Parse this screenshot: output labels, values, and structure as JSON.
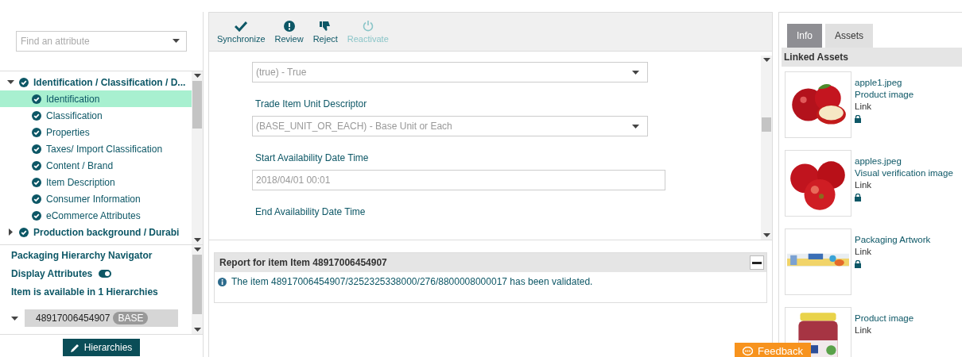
{
  "attribute_search": {
    "placeholder": "Find an attribute"
  },
  "tree": [
    {
      "label": "Identification / Classification / D...",
      "checked": true,
      "expanded": true,
      "selected": false,
      "children": [
        {
          "label": "Identification",
          "checked": true,
          "selected": true
        },
        {
          "label": "Classification",
          "checked": true,
          "selected": false
        },
        {
          "label": "Properties",
          "checked": true,
          "selected": false
        },
        {
          "label": "Taxes/ Import Classification",
          "checked": true,
          "selected": false
        },
        {
          "label": "Content / Brand",
          "checked": true,
          "selected": false
        },
        {
          "label": "Item Description",
          "checked": true,
          "selected": false
        },
        {
          "label": "Consumer Information",
          "checked": true,
          "selected": false
        },
        {
          "label": "eCommerce Attributes",
          "checked": true,
          "selected": false
        }
      ]
    },
    {
      "label": "Production background / Durabi",
      "checked": true,
      "expanded": false,
      "selected": false
    }
  ],
  "navigator": {
    "title": "Packaging Hierarchy Navigator",
    "display_attributes": {
      "label": "Display Attributes",
      "on": true
    },
    "availability": "Item is available in 1 Hierarchies",
    "node": {
      "gtin": "48917006454907",
      "badge": "BASE",
      "expanded": true
    },
    "button": "Hierarchies"
  },
  "toolbar": [
    {
      "kind": "check",
      "label": "Synchronize",
      "disabled": false
    },
    {
      "kind": "alert",
      "label": "Review",
      "disabled": false
    },
    {
      "kind": "thumbdown",
      "label": "Reject",
      "disabled": false
    },
    {
      "kind": "power",
      "label": "Reactivate",
      "disabled": true
    }
  ],
  "form_fields": [
    {
      "kind": "select",
      "value": "(true) - True"
    },
    {
      "kind": "select",
      "label": "Trade Item Unit Descriptor",
      "value": "(BASE_UNIT_OR_EACH) - Base Unit or Each"
    },
    {
      "kind": "text",
      "label": "Start Availability Date Time",
      "value": "2018/04/01 00:01"
    },
    {
      "kind": "label",
      "label": "End Availability Date Time"
    }
  ],
  "report": {
    "title": "Report for item Item 48917006454907",
    "message": "The item 48917006454907/3252325338000/276/8800008000017 has been validated."
  },
  "tabs": [
    {
      "label": "Info",
      "selected": false
    },
    {
      "label": "Assets",
      "selected": true
    }
  ],
  "linked_assets": {
    "title": "Linked Assets",
    "items": [
      {
        "kind": "picture",
        "name": "apple1.jpeg",
        "type": "Product image",
        "link": "Link",
        "locked": true
      },
      {
        "kind": "picture",
        "name": "apples.jpeg",
        "type": "Visual verification image",
        "link": "Link",
        "locked": true
      },
      {
        "kind": "picture",
        "type": "Packaging Artwork",
        "link": "Link",
        "locked": true
      },
      {
        "kind": "picture",
        "type": "Product image",
        "link": "Link"
      }
    ]
  },
  "feedback": "Feedback"
}
